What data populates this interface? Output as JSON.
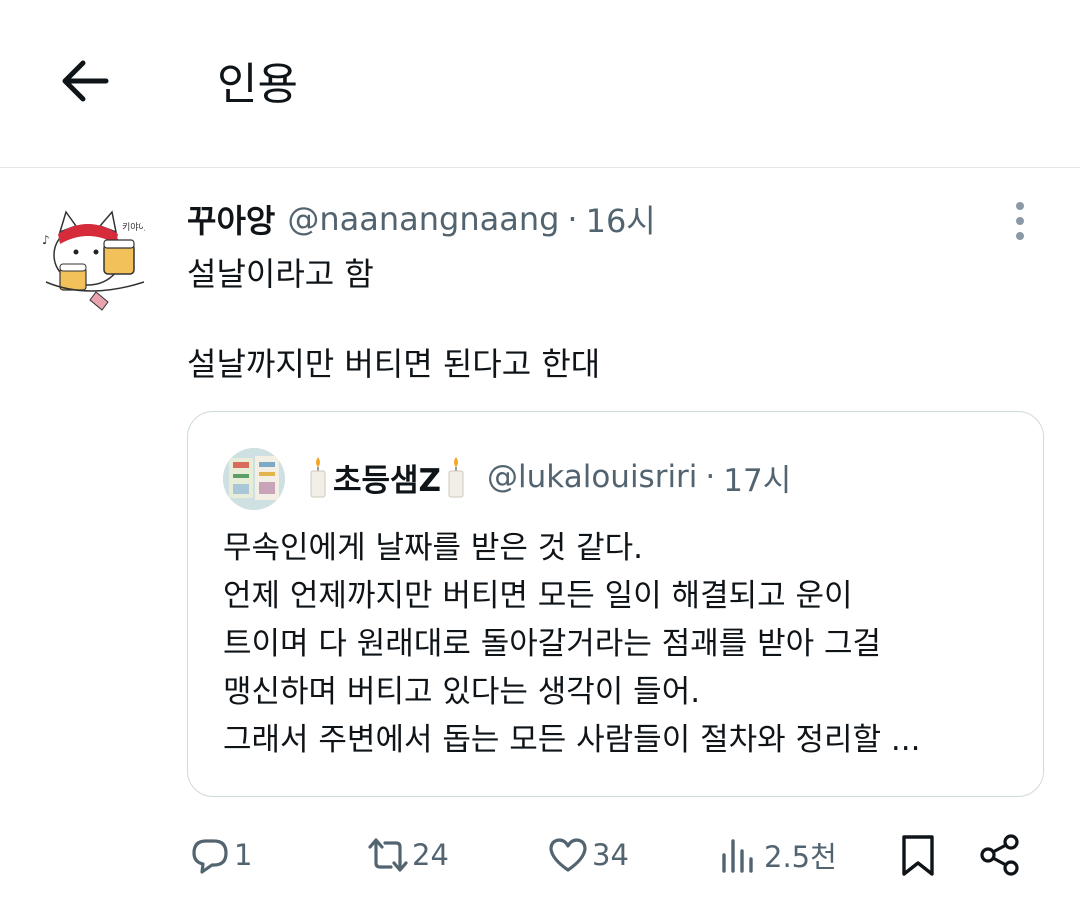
{
  "header": {
    "title": "인용"
  },
  "tweet": {
    "display_name": "꾸아앙",
    "handle": "@naanangnaang",
    "separator": "·",
    "time": "16시",
    "lines": [
      "설날이라고 함",
      "설날까지만 버티면 된다고 한대"
    ]
  },
  "quote": {
    "display_name": "초등샘Z",
    "handle": "@lukalouisriri",
    "separator": "·",
    "time": "17시",
    "lines": [
      "무속인에게 날짜를 받은 것 같다.",
      "언제 언제까지만 버티면 모든 일이 해결되고 운이",
      "트이며 다 원래대로 돌아갈거라는 점괘를 받아 그걸",
      "맹신하며 버티고 있다는 생각이 들어.",
      "그래서 주변에서 돕는 모든 사람들이 절차와 정리할 ..."
    ]
  },
  "actions": {
    "replies": "1",
    "retweets": "24",
    "likes": "34",
    "views": "2.5천"
  },
  "icons": {
    "back": "arrow-left-icon",
    "more": "more-vertical-icon",
    "reply": "reply-icon",
    "retweet": "retweet-icon",
    "like": "heart-icon",
    "views": "bar-chart-icon",
    "bookmark": "bookmark-icon",
    "share": "share-icon"
  },
  "colors": {
    "text": "#0f1419",
    "secondary": "#536471",
    "border": "#cfd9de"
  }
}
